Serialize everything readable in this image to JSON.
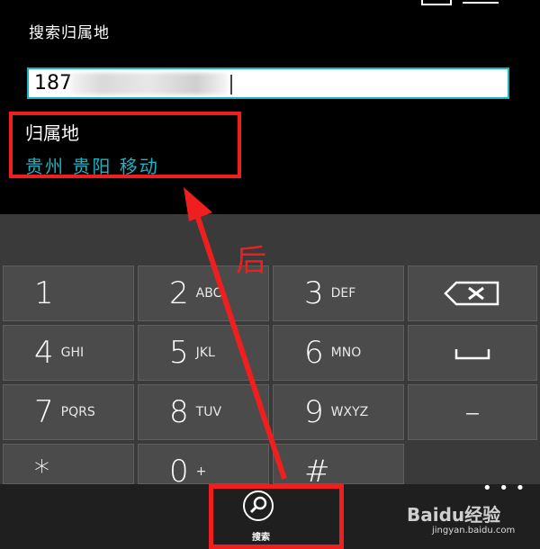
{
  "page": {
    "title": "搜索归属地"
  },
  "number_input": {
    "value": "187"
  },
  "result": {
    "label": "归属地",
    "value": "贵州 贵阳 移动"
  },
  "keypad": {
    "rows": [
      [
        {
          "digit": "1",
          "letters": ""
        },
        {
          "digit": "2",
          "letters": "ABC"
        },
        {
          "digit": "3",
          "letters": "DEF"
        },
        {
          "icon": "backspace-icon"
        }
      ],
      [
        {
          "digit": "4",
          "letters": "GHI"
        },
        {
          "digit": "5",
          "letters": "JKL"
        },
        {
          "digit": "6",
          "letters": "MNO"
        },
        {
          "icon": "space-icon"
        }
      ],
      [
        {
          "digit": "7",
          "letters": "PQRS"
        },
        {
          "digit": "8",
          "letters": "TUV"
        },
        {
          "digit": "9",
          "letters": "WXYZ"
        },
        {
          "icon": "dash-icon",
          "digit": "–"
        }
      ],
      [
        {
          "digit": "*",
          "letters": ""
        },
        {
          "digit": "0",
          "letters": "+"
        },
        {
          "digit": "#",
          "letters": ""
        }
      ]
    ]
  },
  "appbar": {
    "search_label": "搜索",
    "more": "• • •"
  },
  "annotation": {
    "text": "后",
    "color": "#ef1f1f"
  },
  "watermark": {
    "brand": "Baidu经验",
    "url": "jingyan.baidu.com"
  },
  "colors": {
    "accent": "#1bb3c4",
    "highlight": "#ef1f1f"
  }
}
